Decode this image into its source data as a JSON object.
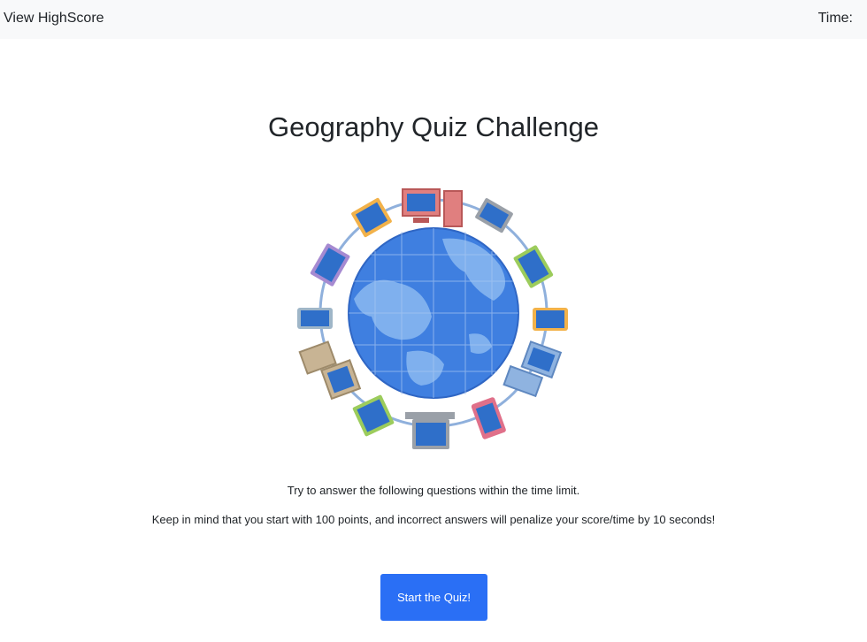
{
  "nav": {
    "highscore_label": "View HighScore",
    "time_label": "Time:"
  },
  "quiz": {
    "title": "Geography Quiz Challenge",
    "instruction_1": "Try to answer the following questions within the time limit.",
    "instruction_2": "Keep in mind that you start with 100 points, and incorrect answers will penalize your score/time by 10 seconds!",
    "start_label": "Start the Quiz!"
  },
  "colors": {
    "nav_bg": "#f8f9fa",
    "button_bg": "#2a6ff5",
    "globe_blue": "#3f7fe0",
    "ring": "#8fb0dc"
  },
  "illustration": {
    "icon": "globe-with-devices-icon"
  }
}
